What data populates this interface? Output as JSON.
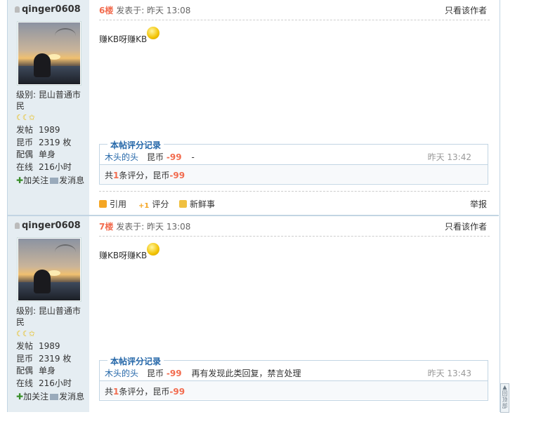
{
  "posts": [
    {
      "username": "qinger0608",
      "level_label": "级别: 昆山普通市民",
      "stars": "☾☾✩",
      "stats": [
        {
          "label": "发帖",
          "value": "1989"
        },
        {
          "label": "昆币",
          "value": "2319 枚"
        },
        {
          "label": "配偶",
          "value": "单身"
        },
        {
          "label": "在线",
          "value": "216小时"
        }
      ],
      "follow_label": "加关注",
      "message_label": "发消息",
      "floor": "6楼",
      "posted_at": "发表于: 昨天 13:08",
      "author_only": "只看该作者",
      "body": "赚KB呀赚KB",
      "rating_title": "本帖评分记录",
      "rating_user": "木头的头",
      "rating_coin": "昆币",
      "rating_value": "-99",
      "rating_reason": "-",
      "rating_time": "昨天 13:42",
      "summary_prefix": "共",
      "summary_count": "1",
      "summary_mid": "条评分，昆币",
      "summary_value": "-99",
      "quote_label": "引用",
      "rate_label": "评分",
      "fresh_label": "新鲜事",
      "report_label": "举报"
    },
    {
      "username": "qinger0608",
      "level_label": "级别: 昆山普通市民",
      "stars": "☾☾✩",
      "stats": [
        {
          "label": "发帖",
          "value": "1989"
        },
        {
          "label": "昆币",
          "value": "2319 枚"
        },
        {
          "label": "配偶",
          "value": "单身"
        },
        {
          "label": "在线",
          "value": "216小时"
        }
      ],
      "follow_label": "加关注",
      "message_label": "发消息",
      "floor": "7楼",
      "posted_at": "发表于: 昨天 13:08",
      "author_only": "只看该作者",
      "body": "赚KB呀赚KB",
      "rating_title": "本帖评分记录",
      "rating_user": "木头的头",
      "rating_coin": "昆币",
      "rating_value": "-99",
      "rating_reason": "再有发现此类回复，禁言处理",
      "rating_time": "昨天 13:43",
      "summary_prefix": "共",
      "summary_count": "1",
      "summary_mid": "条评分，昆币",
      "summary_value": "-99"
    }
  ],
  "back_to_top": "回顶部",
  "colors": {
    "accent": "#2366a8",
    "floor": "#f26c4f",
    "sidebar_bg": "#e5edf2",
    "border": "#c2d5e3"
  }
}
